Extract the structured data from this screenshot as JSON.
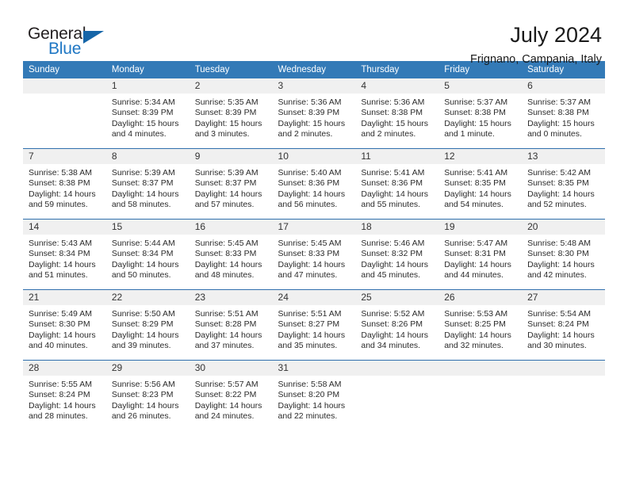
{
  "brand": {
    "word1": "General",
    "word2": "Blue",
    "triangle_color": "#1565a8",
    "blue_color": "#1f77c4"
  },
  "header": {
    "title": "July 2024",
    "location": "Frignano, Campania, Italy"
  },
  "theme": {
    "header_bg": "#337ab7",
    "daynum_bg": "#f0f0f0",
    "week_divider": "#2f6fad"
  },
  "weekdays": [
    "Sunday",
    "Monday",
    "Tuesday",
    "Wednesday",
    "Thursday",
    "Friday",
    "Saturday"
  ],
  "weeks": [
    [
      {
        "day": "",
        "sunrise": "",
        "sunset": "",
        "daylight_line1": "",
        "daylight_line2": ""
      },
      {
        "day": "1",
        "sunrise": "Sunrise: 5:34 AM",
        "sunset": "Sunset: 8:39 PM",
        "daylight_line1": "Daylight: 15 hours",
        "daylight_line2": "and 4 minutes."
      },
      {
        "day": "2",
        "sunrise": "Sunrise: 5:35 AM",
        "sunset": "Sunset: 8:39 PM",
        "daylight_line1": "Daylight: 15 hours",
        "daylight_line2": "and 3 minutes."
      },
      {
        "day": "3",
        "sunrise": "Sunrise: 5:36 AM",
        "sunset": "Sunset: 8:39 PM",
        "daylight_line1": "Daylight: 15 hours",
        "daylight_line2": "and 2 minutes."
      },
      {
        "day": "4",
        "sunrise": "Sunrise: 5:36 AM",
        "sunset": "Sunset: 8:38 PM",
        "daylight_line1": "Daylight: 15 hours",
        "daylight_line2": "and 2 minutes."
      },
      {
        "day": "5",
        "sunrise": "Sunrise: 5:37 AM",
        "sunset": "Sunset: 8:38 PM",
        "daylight_line1": "Daylight: 15 hours",
        "daylight_line2": "and 1 minute."
      },
      {
        "day": "6",
        "sunrise": "Sunrise: 5:37 AM",
        "sunset": "Sunset: 8:38 PM",
        "daylight_line1": "Daylight: 15 hours",
        "daylight_line2": "and 0 minutes."
      }
    ],
    [
      {
        "day": "7",
        "sunrise": "Sunrise: 5:38 AM",
        "sunset": "Sunset: 8:38 PM",
        "daylight_line1": "Daylight: 14 hours",
        "daylight_line2": "and 59 minutes."
      },
      {
        "day": "8",
        "sunrise": "Sunrise: 5:39 AM",
        "sunset": "Sunset: 8:37 PM",
        "daylight_line1": "Daylight: 14 hours",
        "daylight_line2": "and 58 minutes."
      },
      {
        "day": "9",
        "sunrise": "Sunrise: 5:39 AM",
        "sunset": "Sunset: 8:37 PM",
        "daylight_line1": "Daylight: 14 hours",
        "daylight_line2": "and 57 minutes."
      },
      {
        "day": "10",
        "sunrise": "Sunrise: 5:40 AM",
        "sunset": "Sunset: 8:36 PM",
        "daylight_line1": "Daylight: 14 hours",
        "daylight_line2": "and 56 minutes."
      },
      {
        "day": "11",
        "sunrise": "Sunrise: 5:41 AM",
        "sunset": "Sunset: 8:36 PM",
        "daylight_line1": "Daylight: 14 hours",
        "daylight_line2": "and 55 minutes."
      },
      {
        "day": "12",
        "sunrise": "Sunrise: 5:41 AM",
        "sunset": "Sunset: 8:35 PM",
        "daylight_line1": "Daylight: 14 hours",
        "daylight_line2": "and 54 minutes."
      },
      {
        "day": "13",
        "sunrise": "Sunrise: 5:42 AM",
        "sunset": "Sunset: 8:35 PM",
        "daylight_line1": "Daylight: 14 hours",
        "daylight_line2": "and 52 minutes."
      }
    ],
    [
      {
        "day": "14",
        "sunrise": "Sunrise: 5:43 AM",
        "sunset": "Sunset: 8:34 PM",
        "daylight_line1": "Daylight: 14 hours",
        "daylight_line2": "and 51 minutes."
      },
      {
        "day": "15",
        "sunrise": "Sunrise: 5:44 AM",
        "sunset": "Sunset: 8:34 PM",
        "daylight_line1": "Daylight: 14 hours",
        "daylight_line2": "and 50 minutes."
      },
      {
        "day": "16",
        "sunrise": "Sunrise: 5:45 AM",
        "sunset": "Sunset: 8:33 PM",
        "daylight_line1": "Daylight: 14 hours",
        "daylight_line2": "and 48 minutes."
      },
      {
        "day": "17",
        "sunrise": "Sunrise: 5:45 AM",
        "sunset": "Sunset: 8:33 PM",
        "daylight_line1": "Daylight: 14 hours",
        "daylight_line2": "and 47 minutes."
      },
      {
        "day": "18",
        "sunrise": "Sunrise: 5:46 AM",
        "sunset": "Sunset: 8:32 PM",
        "daylight_line1": "Daylight: 14 hours",
        "daylight_line2": "and 45 minutes."
      },
      {
        "day": "19",
        "sunrise": "Sunrise: 5:47 AM",
        "sunset": "Sunset: 8:31 PM",
        "daylight_line1": "Daylight: 14 hours",
        "daylight_line2": "and 44 minutes."
      },
      {
        "day": "20",
        "sunrise": "Sunrise: 5:48 AM",
        "sunset": "Sunset: 8:30 PM",
        "daylight_line1": "Daylight: 14 hours",
        "daylight_line2": "and 42 minutes."
      }
    ],
    [
      {
        "day": "21",
        "sunrise": "Sunrise: 5:49 AM",
        "sunset": "Sunset: 8:30 PM",
        "daylight_line1": "Daylight: 14 hours",
        "daylight_line2": "and 40 minutes."
      },
      {
        "day": "22",
        "sunrise": "Sunrise: 5:50 AM",
        "sunset": "Sunset: 8:29 PM",
        "daylight_line1": "Daylight: 14 hours",
        "daylight_line2": "and 39 minutes."
      },
      {
        "day": "23",
        "sunrise": "Sunrise: 5:51 AM",
        "sunset": "Sunset: 8:28 PM",
        "daylight_line1": "Daylight: 14 hours",
        "daylight_line2": "and 37 minutes."
      },
      {
        "day": "24",
        "sunrise": "Sunrise: 5:51 AM",
        "sunset": "Sunset: 8:27 PM",
        "daylight_line1": "Daylight: 14 hours",
        "daylight_line2": "and 35 minutes."
      },
      {
        "day": "25",
        "sunrise": "Sunrise: 5:52 AM",
        "sunset": "Sunset: 8:26 PM",
        "daylight_line1": "Daylight: 14 hours",
        "daylight_line2": "and 34 minutes."
      },
      {
        "day": "26",
        "sunrise": "Sunrise: 5:53 AM",
        "sunset": "Sunset: 8:25 PM",
        "daylight_line1": "Daylight: 14 hours",
        "daylight_line2": "and 32 minutes."
      },
      {
        "day": "27",
        "sunrise": "Sunrise: 5:54 AM",
        "sunset": "Sunset: 8:24 PM",
        "daylight_line1": "Daylight: 14 hours",
        "daylight_line2": "and 30 minutes."
      }
    ],
    [
      {
        "day": "28",
        "sunrise": "Sunrise: 5:55 AM",
        "sunset": "Sunset: 8:24 PM",
        "daylight_line1": "Daylight: 14 hours",
        "daylight_line2": "and 28 minutes."
      },
      {
        "day": "29",
        "sunrise": "Sunrise: 5:56 AM",
        "sunset": "Sunset: 8:23 PM",
        "daylight_line1": "Daylight: 14 hours",
        "daylight_line2": "and 26 minutes."
      },
      {
        "day": "30",
        "sunrise": "Sunrise: 5:57 AM",
        "sunset": "Sunset: 8:22 PM",
        "daylight_line1": "Daylight: 14 hours",
        "daylight_line2": "and 24 minutes."
      },
      {
        "day": "31",
        "sunrise": "Sunrise: 5:58 AM",
        "sunset": "Sunset: 8:20 PM",
        "daylight_line1": "Daylight: 14 hours",
        "daylight_line2": "and 22 minutes."
      },
      {
        "day": "",
        "sunrise": "",
        "sunset": "",
        "daylight_line1": "",
        "daylight_line2": ""
      },
      {
        "day": "",
        "sunrise": "",
        "sunset": "",
        "daylight_line1": "",
        "daylight_line2": ""
      },
      {
        "day": "",
        "sunrise": "",
        "sunset": "",
        "daylight_line1": "",
        "daylight_line2": ""
      }
    ]
  ]
}
